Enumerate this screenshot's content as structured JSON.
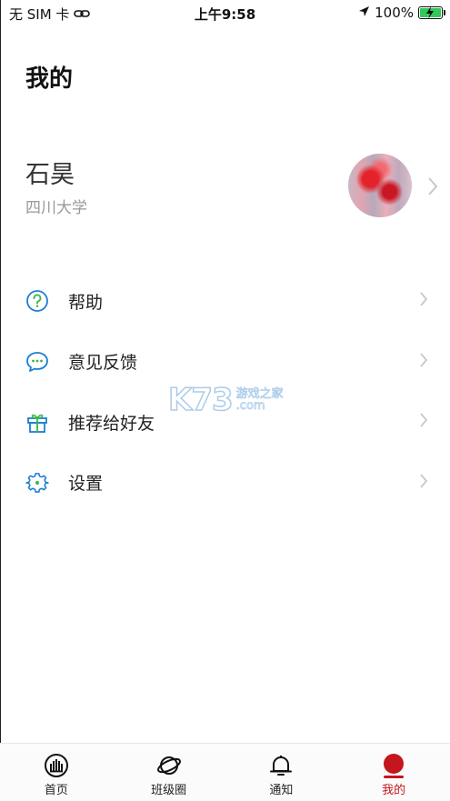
{
  "status_bar": {
    "carrier": "无 SIM 卡",
    "time": "上午9:58",
    "battery": "100%"
  },
  "page": {
    "title": "我的"
  },
  "profile": {
    "name": "石昊",
    "school": "四川大学"
  },
  "menu": {
    "items": [
      {
        "label": "帮助",
        "icon": "help-icon"
      },
      {
        "label": "意见反馈",
        "icon": "feedback-icon"
      },
      {
        "label": "推荐给好友",
        "icon": "gift-icon"
      },
      {
        "label": "设置",
        "icon": "settings-icon"
      }
    ]
  },
  "watermark": {
    "logo": "K73",
    "name": "游戏之家",
    "domain": ".com"
  },
  "tab_bar": {
    "tabs": [
      {
        "label": "首页",
        "icon": "home-icon"
      },
      {
        "label": "班级圈",
        "icon": "planet-icon"
      },
      {
        "label": "通知",
        "icon": "bell-icon"
      },
      {
        "label": "我的",
        "icon": "profile-dot-icon",
        "active": true
      }
    ]
  },
  "colors": {
    "accent": "#c4161c",
    "icon_blue": "#1a7fd4",
    "icon_green": "#3ab54a",
    "chevron": "#c7c7cc",
    "battery": "#34c759"
  }
}
